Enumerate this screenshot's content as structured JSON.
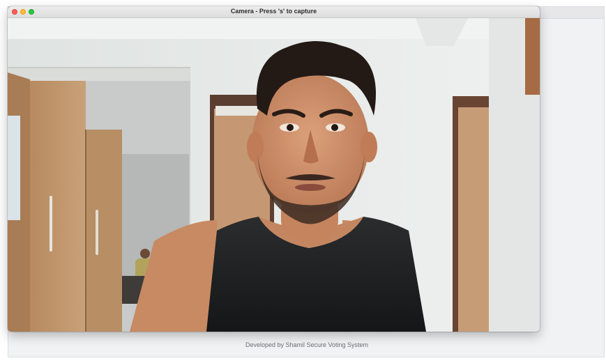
{
  "window": {
    "title": "Camera - Press 's' to capture"
  },
  "app": {
    "footer_text": "Developed by Shamil Secure Voting System"
  },
  "controls": {
    "close": "close",
    "minimize": "minimize",
    "maximize": "maximize"
  },
  "feed": {
    "content": "live camera preview"
  },
  "colors": {
    "close": "#fe5f57",
    "minimize": "#febc2e",
    "maximize": "#28c840",
    "wall": "#e9ecea",
    "wood": "#c69c72",
    "tanktop": "#1e2022",
    "skin": "#d0936d"
  }
}
